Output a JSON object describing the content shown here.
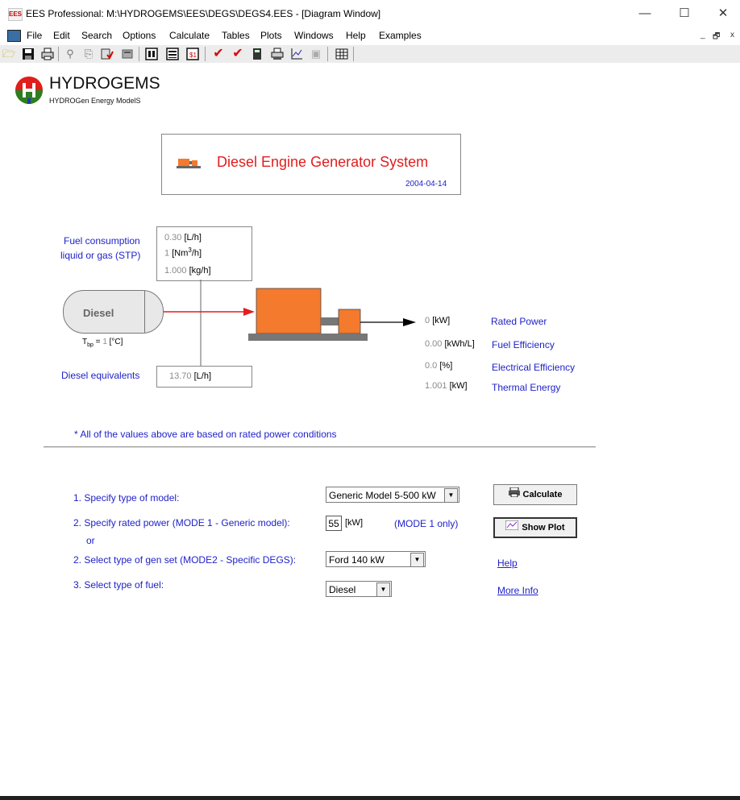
{
  "window": {
    "app_icon": "EES",
    "title": "EES Professional:  M:\\HYDROGEMS\\EES\\DEGS\\DEGS4.EES - [Diagram Window]",
    "minimize": "—",
    "maximize": "☐",
    "close": "✕"
  },
  "menu": {
    "items": [
      "File",
      "Edit",
      "Search",
      "Options",
      "Calculate",
      "Tables",
      "Plots",
      "Windows",
      "Help",
      "Examples"
    ],
    "mdi_minimize": "_",
    "mdi_restore": "🗗",
    "mdi_close": "x"
  },
  "toolbar": {
    "icons": [
      "open-icon",
      "save-icon",
      "print-icon",
      "find-icon",
      "copy-icon",
      "paste-icon",
      "check-units-icon",
      "equations-icon",
      "solution-icon",
      "formatted-icon",
      "check-icon",
      "solve-icon",
      "calculator-icon",
      "print-window-icon",
      "plot-icon",
      "lookup-icon",
      "table-icon"
    ]
  },
  "brand": {
    "name": "HYDROGEMS",
    "tagline": "HYDROGen Energy ModelS"
  },
  "header_box": {
    "title": "Diesel Engine Generator System",
    "date": "2004-04-14"
  },
  "fuel": {
    "label_line1": "Fuel consumption",
    "label_line2": "liquid or gas (STP)",
    "lph_value": "0.30",
    "lph_unit": "[L/h]",
    "nm3_value": "1",
    "nm3_unit_pre": "[Nm",
    "nm3_unit_sup": "3",
    "nm3_unit_post": "/h]",
    "kgh_value": "1.000",
    "kgh_unit": "[kg/h]",
    "tank_label": "Diesel",
    "tbp_label": "T",
    "tbp_sub": "bp",
    "tbp_eq": " = ",
    "tbp_value": "1",
    "tbp_unit": " [°C]",
    "equiv_label": "Diesel equivalents",
    "equiv_value": "13.70",
    "equiv_unit": "[L/h]"
  },
  "outputs": [
    {
      "value": "0",
      "unit": "[kW]",
      "label": "Rated Power"
    },
    {
      "value": "0.00",
      "unit": "[kWh/L]",
      "label": "Fuel Efficiency"
    },
    {
      "value": "0.0",
      "unit": "[%]",
      "label": "Electrical Efficiency"
    },
    {
      "value": "1.001",
      "unit": "[kW]",
      "label": "Thermal Energy"
    }
  ],
  "footnote": "* All of the values above are based on rated power conditions",
  "form": {
    "step1_label": "1. Specify type of model:",
    "step1_value": "Generic Model 5-500 kW",
    "step2a_label": "2. Specify rated power (MODE 1 - Generic model):",
    "step2a_or": "or",
    "step2a_value": "55",
    "step2a_unit": "[kW]",
    "step2a_note": "(MODE 1 only)",
    "step2b_label": "2. Select type of gen set (MODE2 - Specific DEGS):",
    "step2b_value": "Ford 140 kW",
    "step3_label": "3. Select type of fuel:",
    "step3_value": "Diesel",
    "dropdown_arrow": "▼",
    "calculate_label": "Calculate",
    "show_plot_label": "Show Plot",
    "help_link": "Help",
    "more_info_link": "More Info"
  }
}
